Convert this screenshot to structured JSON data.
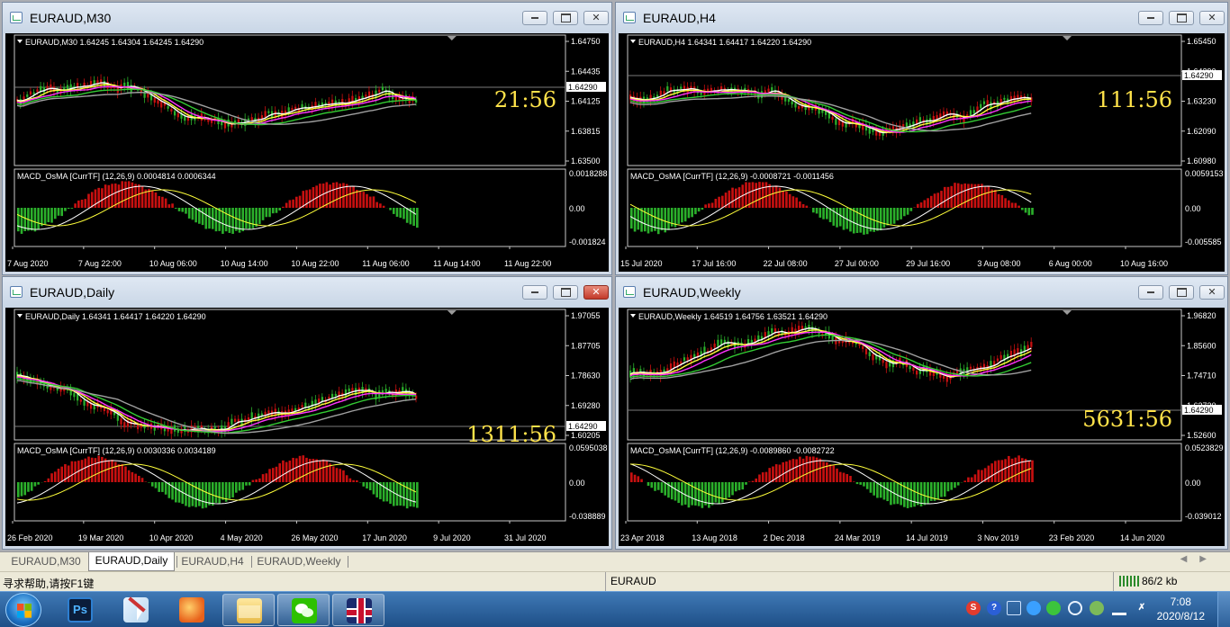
{
  "windows": [
    {
      "id": "m30",
      "title": "EURAUD,M30",
      "close_active": false,
      "header": "EURAUD,M30  1.64245 1.64304 1.64245 1.64290",
      "price_labels": [
        "1.64750",
        "1.64435",
        "1.64125",
        "1.63815",
        "1.63500"
      ],
      "current_price": "1.64290",
      "timer": "21:56",
      "osc_label": "MACD_OsMA [CurrTF] (12,26,9) 0.0004814 0.0006344",
      "osc_labels": [
        "0.0018288",
        "0.00",
        "-0.001824"
      ],
      "time_labels": [
        "7 Aug 2020",
        "7 Aug 22:00",
        "10 Aug 06:00",
        "10 Aug 14:00",
        "10 Aug 22:00",
        "11 Aug 06:00",
        "11 Aug 14:00",
        "11 Aug 22:00"
      ],
      "seed": 11
    },
    {
      "id": "h4",
      "title": "EURAUD,H4",
      "close_active": false,
      "header": "EURAUD,H4  1.64341 1.64417 1.64220 1.64290",
      "price_labels": [
        "1.65450",
        "1.64290",
        "1.63230",
        "1.62090",
        "1.60980"
      ],
      "current_price": "1.64290",
      "timer": "111:56",
      "osc_label": "MACD_OsMA [CurrTF] (12,26,9) -0.0008721 -0.0011456",
      "osc_labels": [
        "0.0059153",
        "0.00",
        "-0.005585"
      ],
      "time_labels": [
        "15 Jul 2020",
        "17 Jul 16:00",
        "22 Jul 08:00",
        "27 Jul 00:00",
        "29 Jul 16:00",
        "3 Aug 08:00",
        "6 Aug 00:00",
        "10 Aug 16:00"
      ],
      "seed": 23
    },
    {
      "id": "daily",
      "title": "EURAUD,Daily",
      "close_active": true,
      "header": "EURAUD,Daily  1.64341 1.64417 1.64220 1.64290",
      "price_labels": [
        "1.97055",
        "1.87705",
        "1.78630",
        "1.69280",
        "1.60205"
      ],
      "current_price": "1.64290",
      "timer": "1311:56",
      "osc_label": "MACD_OsMA [CurrTF] (12,26,9) 0.0030336 0.0034189",
      "osc_labels": [
        "0.0595038",
        "0.00",
        "-0.038889"
      ],
      "time_labels": [
        "26 Feb 2020",
        "19 Mar 2020",
        "10 Apr 2020",
        "4 May 2020",
        "26 May 2020",
        "17 Jun 2020",
        "9 Jul 2020",
        "31 Jul 2020"
      ],
      "seed": 37
    },
    {
      "id": "weekly",
      "title": "EURAUD,Weekly",
      "close_active": false,
      "header": "EURAUD,Weekly  1.64519 1.64756 1.63521 1.64290",
      "price_labels": [
        "1.96820",
        "1.85600",
        "1.74710",
        "1.63730",
        "1.52600"
      ],
      "current_price": "1.64290",
      "timer": "5631:56",
      "osc_label": "MACD_OsMA [CurrTF] (12,26,9) -0.0089860 -0.0082722",
      "osc_labels": [
        "0.0523829",
        "0.00",
        "-0.039012"
      ],
      "time_labels": [
        "23 Apr 2018",
        "13 Aug 2018",
        "2 Dec 2018",
        "24 Mar 2019",
        "14 Jul 2019",
        "3 Nov 2019",
        "23 Feb 2020",
        "14 Jun 2020"
      ],
      "seed": 53
    }
  ],
  "tabs": [
    "EURAUD,M30",
    "EURAUD,Daily",
    "EURAUD,H4",
    "EURAUD,Weekly"
  ],
  "active_tab": 1,
  "status": {
    "help": "寻求帮助,请按F1键",
    "symbol": "EURAUD",
    "connection": "86/2 kb"
  },
  "taskbar": {
    "apps": [
      {
        "name": "photoshop",
        "icon": "photoshop-icon",
        "label": "Ps"
      },
      {
        "name": "paint",
        "icon": "paint-icon"
      },
      {
        "name": "foxmail",
        "icon": "foxmail-icon"
      },
      {
        "name": "explorer",
        "icon": "folder-icon"
      },
      {
        "name": "wechat",
        "icon": "wechat-icon"
      },
      {
        "name": "metatrader",
        "icon": "union-jack-icon"
      }
    ],
    "clock_time": "7:08",
    "clock_date": "2020/8/12"
  },
  "colors": {
    "bull": "#2bb02b",
    "bear": "#c81010",
    "ma_white": "#ffffff",
    "ma_yellow": "#ffff3a",
    "ma_magenta": "#ff33ff",
    "ma_green": "#33cc33",
    "ma_gray": "#a0a0a0",
    "timer": "#ffe34a"
  }
}
